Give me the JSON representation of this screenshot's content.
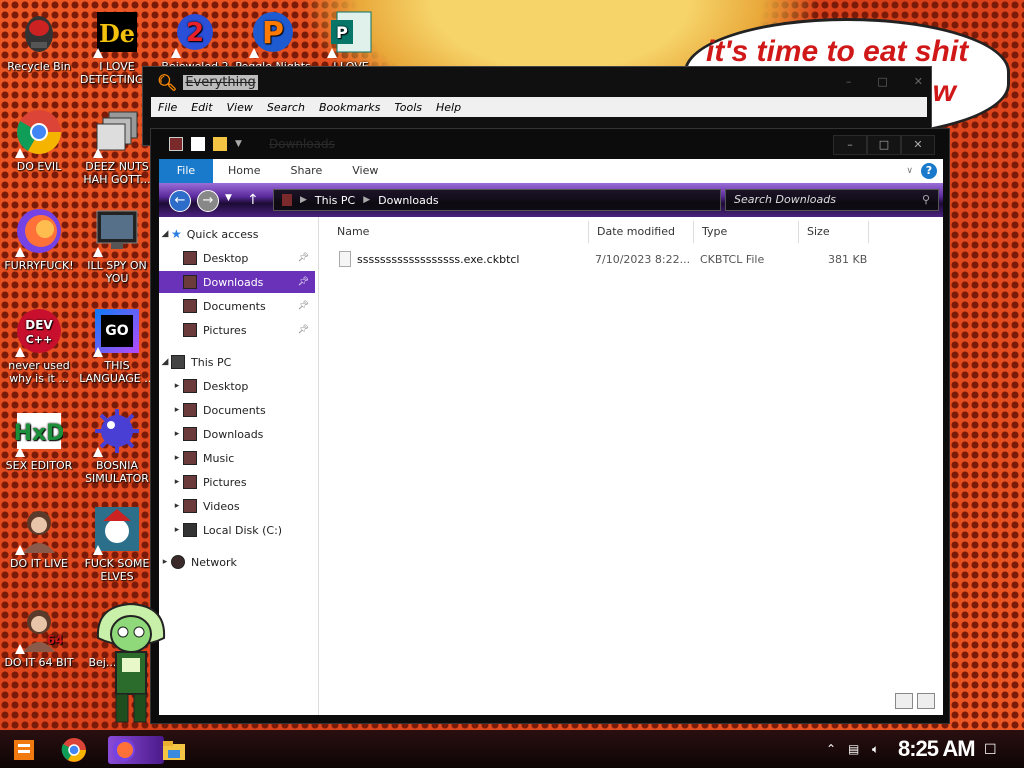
{
  "wallpaper": {
    "bubble_line1": "it's time to eat shit",
    "bubble_line2": "w"
  },
  "desktop_icons": [
    {
      "label": "Recycle Bin"
    },
    {
      "label": "I LOVE DETECTING..."
    },
    {
      "label": "Bejeweled 2"
    },
    {
      "label": "Peggle Nights"
    },
    {
      "label": "I LOVE"
    },
    {
      "label": "DO EVIL"
    },
    {
      "label": "DEEZ NUTS HAH GOTT..."
    },
    {
      "label": "FURRYFUCK!"
    },
    {
      "label": "ILL SPY ON YOU"
    },
    {
      "label": "never used why is it ..."
    },
    {
      "label": "THIS LANGUAGE ..."
    },
    {
      "label": "SEX EDITOR"
    },
    {
      "label": "BOSNIA SIMULATOR"
    },
    {
      "label": "DO IT LIVE"
    },
    {
      "label": "FUCK SOME ELVES"
    },
    {
      "label": "DO IT 64 BIT"
    },
    {
      "label": "Bej... De..."
    }
  ],
  "everything_window": {
    "title": "Everything",
    "menu": [
      "File",
      "Edit",
      "View",
      "Search",
      "Bookmarks",
      "Tools",
      "Help"
    ]
  },
  "explorer": {
    "title": "Downloads",
    "ribbon_tabs": [
      "File",
      "Home",
      "Share",
      "View"
    ],
    "address": {
      "root": "This PC",
      "folder": "Downloads"
    },
    "search_placeholder": "Search Downloads",
    "quick_access": {
      "label": "Quick access",
      "items": [
        "Desktop",
        "Downloads",
        "Documents",
        "Pictures"
      ]
    },
    "this_pc": {
      "label": "This PC",
      "items": [
        "Desktop",
        "Documents",
        "Downloads",
        "Music",
        "Pictures",
        "Videos",
        "Local Disk (C:)"
      ]
    },
    "network": "Network",
    "columns": [
      "Name",
      "Date modified",
      "Type",
      "Size"
    ],
    "files": [
      {
        "name": "ssssssssssssssssss.exe.ckbtcl",
        "date": "7/10/2023 8:22...",
        "type": "CKBTCL File",
        "size": "381 KB"
      }
    ]
  },
  "taskbar": {
    "time": "8:25 AM"
  }
}
